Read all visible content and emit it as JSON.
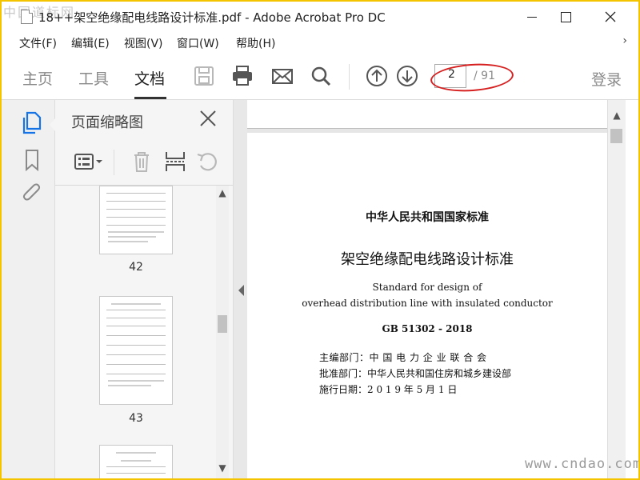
{
  "window": {
    "title": "18++架空绝缘配电线路设计标准.pdf - Adobe Acrobat Pro DC",
    "watermark_top": "中国道标网",
    "watermark_bottom": "www.cndao.com"
  },
  "menu": [
    "文件(F)",
    "编辑(E)",
    "视图(V)",
    "窗口(W)",
    "帮助(H)"
  ],
  "menu_more": "›",
  "tabs": [
    "主页",
    "工具",
    "文档"
  ],
  "active_tab": "文档",
  "pager": {
    "current": "2",
    "total": "/ 91"
  },
  "login": "登录",
  "icons": {
    "save": "save-icon",
    "print": "printer-icon",
    "mail": "mail-icon",
    "search": "search-icon",
    "prev_page": "arrow-up-circle-icon",
    "next_page": "arrow-down-circle-icon",
    "nav_pages": "pages-icon",
    "nav_bookmarks": "bookmark-icon",
    "nav_attach": "paperclip-icon"
  },
  "panel": {
    "title": "页面缩略图",
    "thumbnails": [
      {
        "label": "42"
      },
      {
        "label": "43"
      }
    ]
  },
  "document": {
    "heading": "中华人民共和国国家标准",
    "title": "架空绝缘配电线路设计标准",
    "en_line1": "Standard for design of",
    "en_line2": "overhead distribution line with insulated conductor",
    "code": "GB 51302 - 2018",
    "info": [
      "主编部门：中 国 电 力 企 业 联 合 会",
      "批准部门：中华人民共和国住房和城乡建设部",
      "施行日期：2 0 1 9 年 5 月 1 日"
    ]
  },
  "colors": {
    "accent_blue": "#1473e6",
    "frame_yellow": "#f5c400",
    "annotation_red": "#d62020"
  }
}
